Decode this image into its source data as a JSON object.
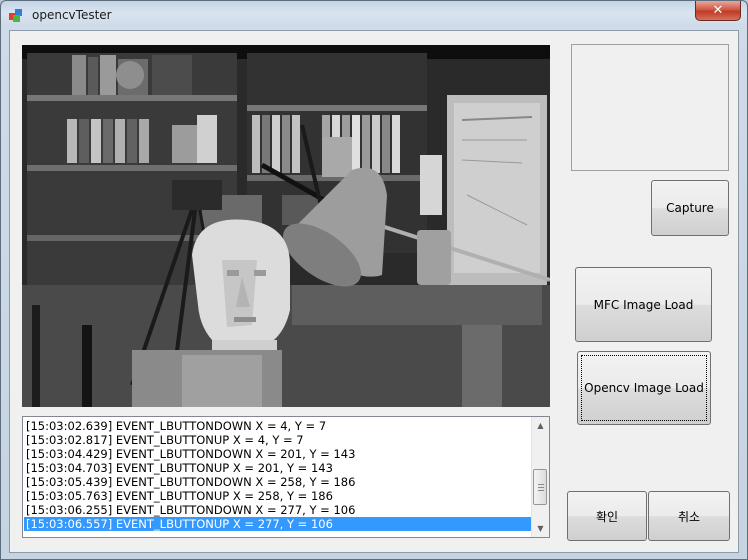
{
  "window": {
    "title": "opencvTester",
    "close_label": "✕"
  },
  "buttons": {
    "capture": "Capture",
    "mfc_load": "MFC Image Load",
    "opencv_load": "Opencv Image Load",
    "ok": "확인",
    "cancel": "취소"
  },
  "log": {
    "entries": [
      "[15:03:02.639] EVENT_LBUTTONDOWN X = 4, Y = 7",
      "[15:03:02.817] EVENT_LBUTTONUP X = 4, Y = 7",
      "[15:03:04.429] EVENT_LBUTTONDOWN X = 201, Y = 143",
      "[15:03:04.703] EVENT_LBUTTONUP X = 201, Y = 143",
      "[15:03:05.439] EVENT_LBUTTONDOWN X = 258, Y = 186",
      "[15:03:05.763] EVENT_LBUTTONUP X = 258, Y = 186",
      "[15:03:06.255] EVENT_LBUTTONDOWN X = 277, Y = 106",
      "[15:03:06.557] EVENT_LBUTTONUP X = 277, Y = 106"
    ],
    "selected_index": 7
  },
  "colors": {
    "selection": "#3399ff",
    "close_button": "#c23a24"
  }
}
